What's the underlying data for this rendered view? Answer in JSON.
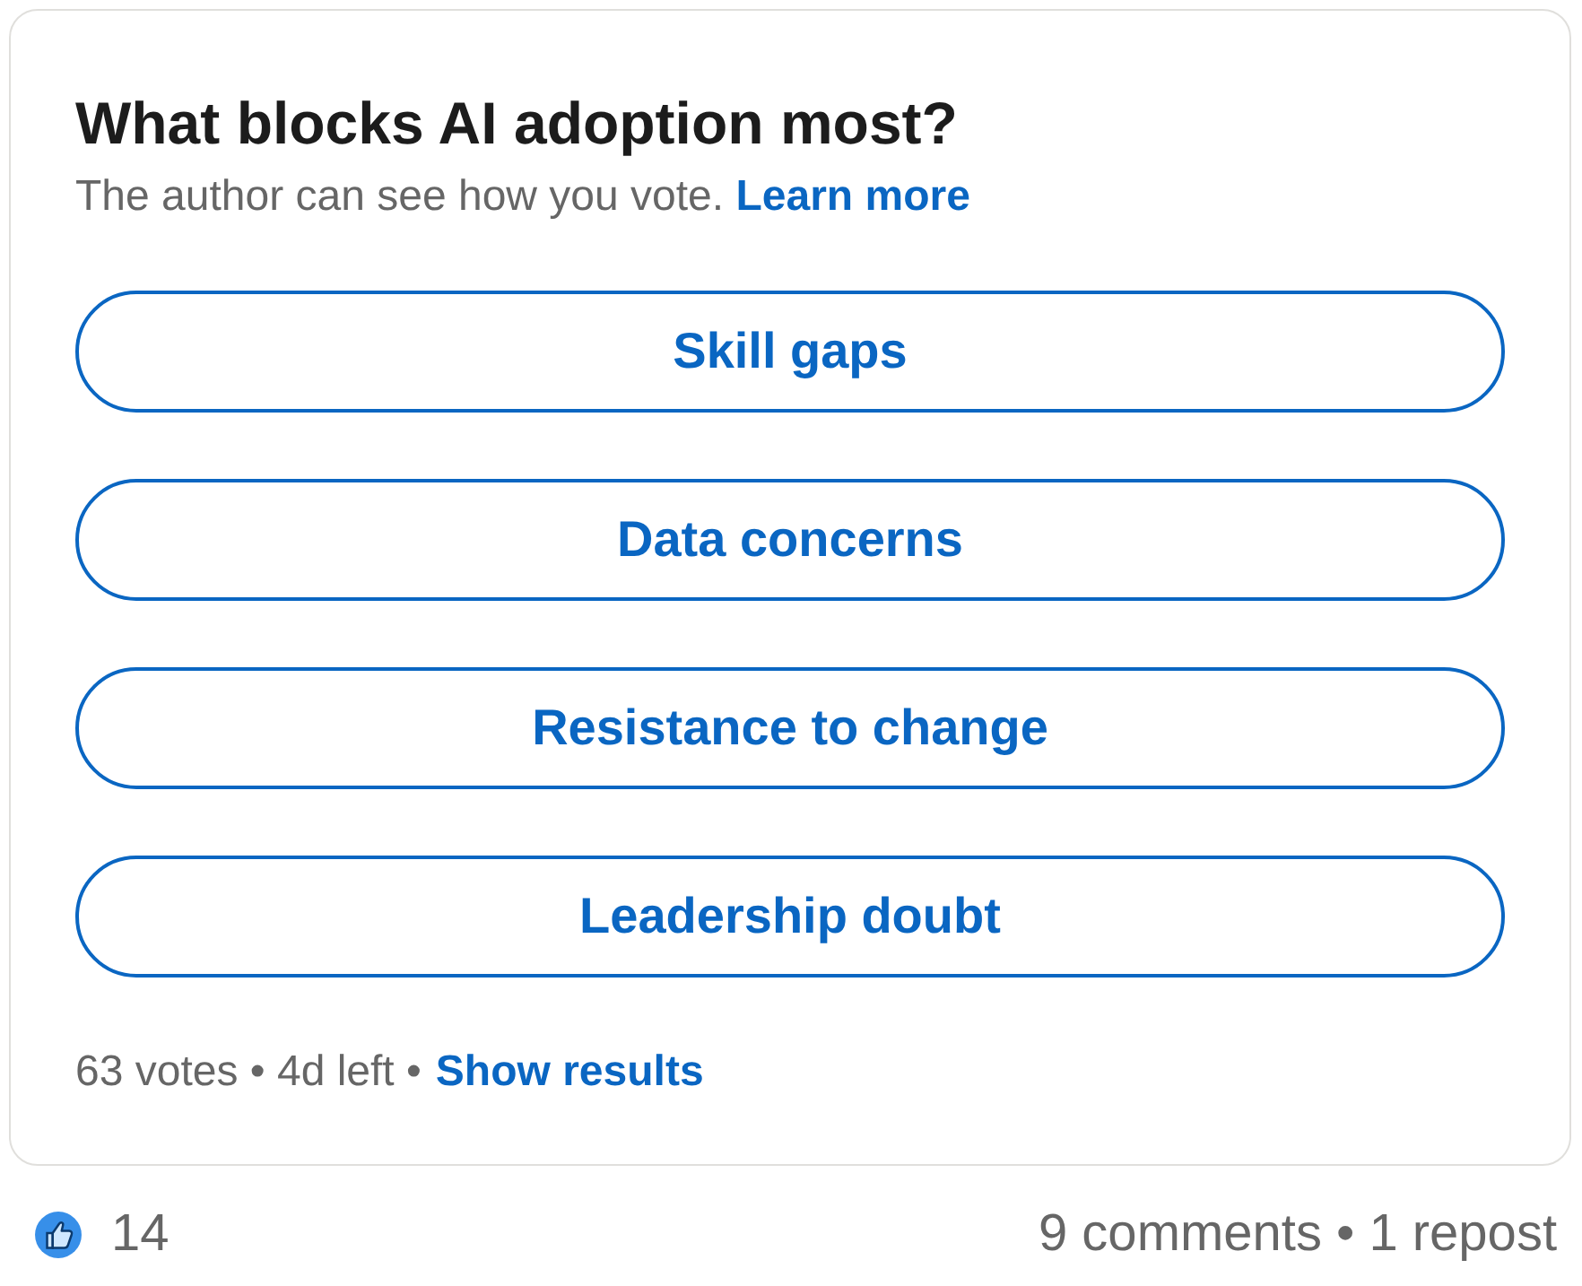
{
  "poll": {
    "question": "What blocks AI adoption most?",
    "notice": "The author can see how you vote.",
    "learn_more": "Learn more",
    "options": [
      {
        "label": "Skill gaps"
      },
      {
        "label": "Data concerns"
      },
      {
        "label": "Resistance to change"
      },
      {
        "label": "Leadership doubt"
      }
    ],
    "stats": "63 votes • 4d left •",
    "show_results": "Show results"
  },
  "social": {
    "reactions": "14",
    "activity": "9 comments • 1 repost"
  }
}
